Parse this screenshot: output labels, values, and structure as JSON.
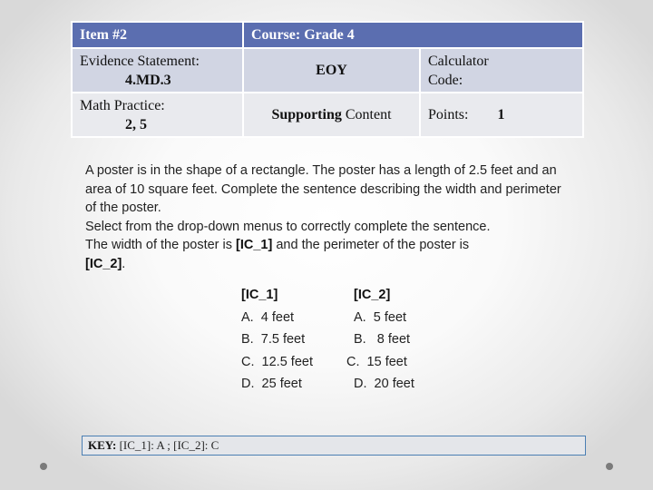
{
  "header_table": {
    "item": "Item #2",
    "course": "Course:   Grade 4",
    "evidence_label": "Evidence Statement:",
    "evidence_value": "4.MD.3",
    "assessment": "EOY",
    "calculator_label_line1": "Calculator",
    "calculator_label_line2": "Code:",
    "math_practice_label": "Math Practice:",
    "math_practice_value": "2, 5",
    "content_bold": "Supporting",
    "content_rest": " Content",
    "points_label": "Points:",
    "points_value": "1"
  },
  "question": {
    "stem": "A poster is in the shape of a rectangle.  The poster has a length of 2.5 feet and an area of 10 square feet.  Complete the sentence describing the width and perimeter of the poster.",
    "instruction": "Select from the drop-down menus to correctly complete the sentence.",
    "sentence_part1": "The width of the poster is ",
    "blank1": "[IC_1]",
    "sentence_part2": " and the perimeter of the poster is ",
    "blank2": "[IC_2]",
    "sentence_end": "."
  },
  "options": {
    "ic1": {
      "header": "[IC_1]",
      "items": [
        "A.  4 feet",
        "B.  7.5 feet",
        "C.  12.5 feet",
        "D.  25 feet"
      ]
    },
    "ic2": {
      "header": "[IC_2]",
      "items": [
        "A.  5 feet",
        "B.   8 feet",
        "C.  15 feet",
        "D.  20 feet"
      ]
    }
  },
  "key": {
    "label": "KEY:",
    "value": " [IC_1]:  A ; [IC_2]:  C"
  }
}
